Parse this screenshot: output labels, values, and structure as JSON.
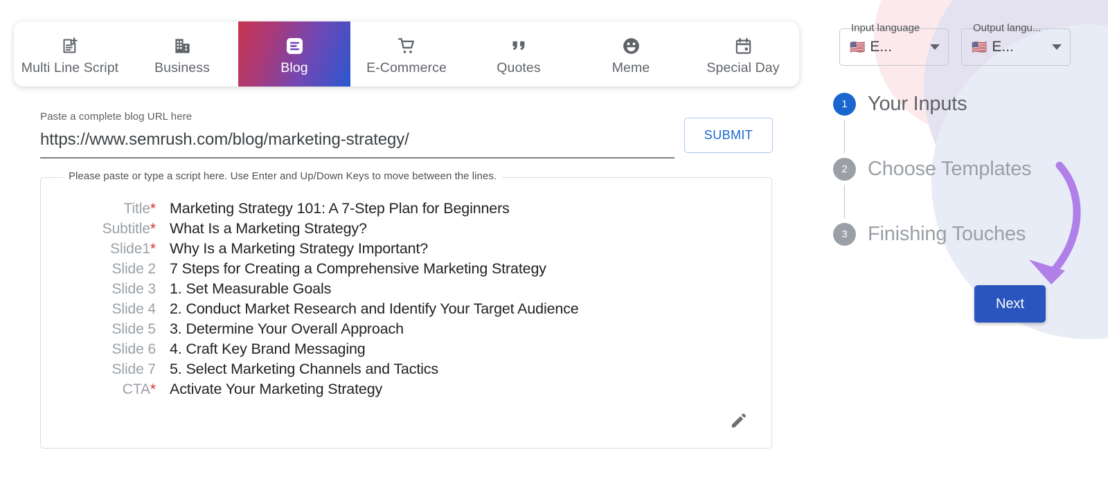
{
  "tabs": [
    {
      "label": "Multi Line Script",
      "icon": "document-plus-icon",
      "active": false
    },
    {
      "label": "Business",
      "icon": "building-icon",
      "active": false
    },
    {
      "label": "Blog",
      "icon": "article-icon",
      "active": true
    },
    {
      "label": "E-Commerce",
      "icon": "shopping-cart-icon",
      "active": false
    },
    {
      "label": "Quotes",
      "icon": "quote-marks-icon",
      "active": false
    },
    {
      "label": "Meme",
      "icon": "smiley-face-icon",
      "active": false
    },
    {
      "label": "Special Day",
      "icon": "calendar-icon",
      "active": false
    }
  ],
  "url_field": {
    "label": "Paste a complete blog URL here",
    "value": "https://www.semrush.com/blog/marketing-strategy/",
    "placeholder": "Paste a complete blog URL here"
  },
  "submit_button": {
    "label": "SUBMIT"
  },
  "script_panel": {
    "legend": "Please paste or type a script here. Use Enter and Up/Down Keys to move between the lines.",
    "lines": [
      {
        "label": "Title",
        "required": true,
        "text": "Marketing Strategy 101: A 7-Step Plan for Beginners"
      },
      {
        "label": "Subtitle",
        "required": true,
        "text": "What Is a Marketing Strategy?"
      },
      {
        "label": "Slide1",
        "required": true,
        "text": "Why Is a Marketing Strategy Important?"
      },
      {
        "label": "Slide 2",
        "required": false,
        "text": "7 Steps for Creating a Comprehensive Marketing Strategy"
      },
      {
        "label": "Slide 3",
        "required": false,
        "text": "1. Set Measurable Goals"
      },
      {
        "label": "Slide 4",
        "required": false,
        "text": "2. Conduct Market Research and Identify Your Target Audience"
      },
      {
        "label": "Slide 5",
        "required": false,
        "text": "3. Determine Your Overall Approach"
      },
      {
        "label": "Slide 6",
        "required": false,
        "text": "4. Craft Key Brand Messaging"
      },
      {
        "label": "Slide 7",
        "required": false,
        "text": "5. Select Marketing Channels and Tactics"
      },
      {
        "label": "CTA",
        "required": true,
        "text": "Activate Your Marketing Strategy"
      }
    ],
    "edit_icon": "pencil-icon"
  },
  "languages": {
    "input": {
      "legend": "Input language",
      "value": "E...",
      "flag": "🇺🇸"
    },
    "output": {
      "legend": "Output langu...",
      "value": "E...",
      "flag": "🇺🇸"
    }
  },
  "steps": [
    {
      "num": "1",
      "label": "Your Inputs",
      "active": true
    },
    {
      "num": "2",
      "label": "Choose Templates",
      "active": false
    },
    {
      "num": "3",
      "label": "Finishing Touches",
      "active": false
    }
  ],
  "next_button": {
    "label": "Next"
  },
  "colors": {
    "accent_blue": "#2b55be",
    "step_active": "#1a65cf",
    "submit_text": "#1967d2",
    "required_star": "#d93025",
    "arrow_purple": "#b07fe8",
    "tab_gradient_start": "#c8354f",
    "tab_gradient_end": "#2b57cf",
    "blob_pink": "#fbe9ec",
    "blob_lavender": "#e4e2f0",
    "blob_blue": "#e8ecf7"
  }
}
